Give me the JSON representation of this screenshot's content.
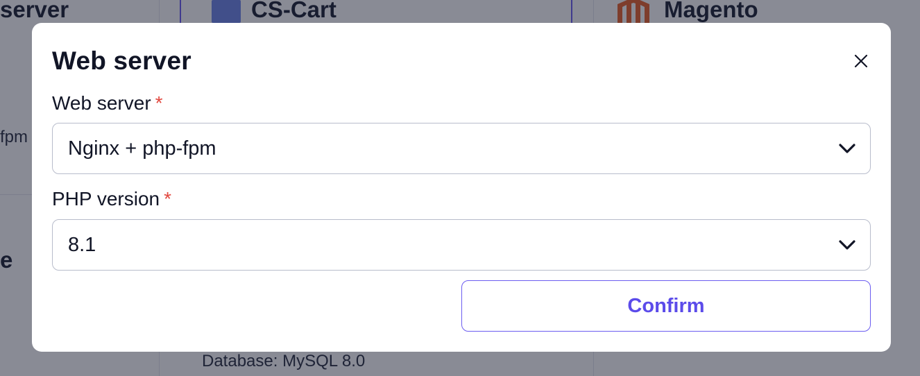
{
  "background": {
    "left_heading": "server",
    "left_text": "fpm",
    "left_heading_2": "e",
    "card_cscart": "CS-Cart",
    "card_magento": "Magento",
    "database_text": "Database: MySQL 8.0"
  },
  "modal": {
    "title": "Web server",
    "close_icon": "close-icon",
    "fields": [
      {
        "label": "Web server",
        "required_mark": "*",
        "value": "Nginx + php-fpm",
        "icon": "chevron-down-icon"
      },
      {
        "label": "PHP version",
        "required_mark": "*",
        "value": "8.1",
        "icon": "chevron-down-icon"
      }
    ],
    "confirm_label": "Confirm"
  },
  "colors": {
    "accent": "#5b4bea",
    "required": "#e2483f",
    "overlay": "rgba(20, 24, 44, 0.5)"
  }
}
